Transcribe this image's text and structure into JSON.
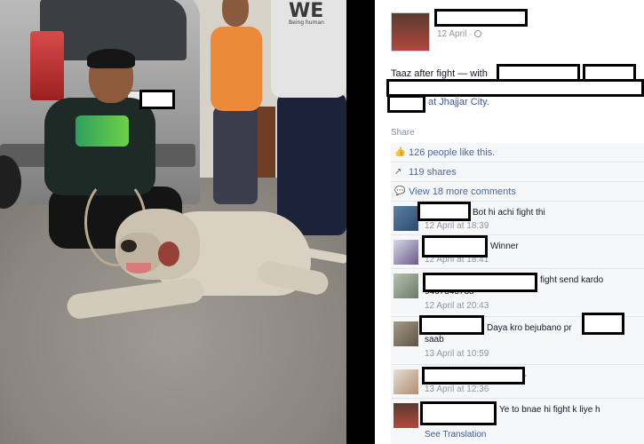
{
  "photo": {
    "shirt_logo": "WE",
    "shirt_logo_sub": "Being human"
  },
  "post": {
    "date": "12 April ·",
    "caption": "Taaz after fight — with",
    "location": "at Jhajjar City."
  },
  "actions": {
    "share_label": "Share",
    "likes_label": "126 people like this.",
    "shares_label": "119 shares",
    "more_comments_label": "View 18 more comments"
  },
  "comments": [
    {
      "text": "Bot hi achi fight thi",
      "time": "12 April at 18:39"
    },
    {
      "text": "Winner",
      "time": "12 April at 18:41"
    },
    {
      "text": "fight send kardo",
      "text2": "9467345738",
      "time": "12 April at 20:43"
    },
    {
      "text": "Daya kro bejubano pr",
      "text2": "saab",
      "time": "13 April at 10:59"
    },
    {
      "text": "--",
      "time": "13 April at 12:36"
    },
    {
      "text": "Ye to bnae hi fight k liye h",
      "see_translation": "See Translation"
    }
  ],
  "colors": {
    "link": "#3b5998",
    "meta_gray": "#8f959d",
    "feedback_bg": "#f6f7f9"
  }
}
